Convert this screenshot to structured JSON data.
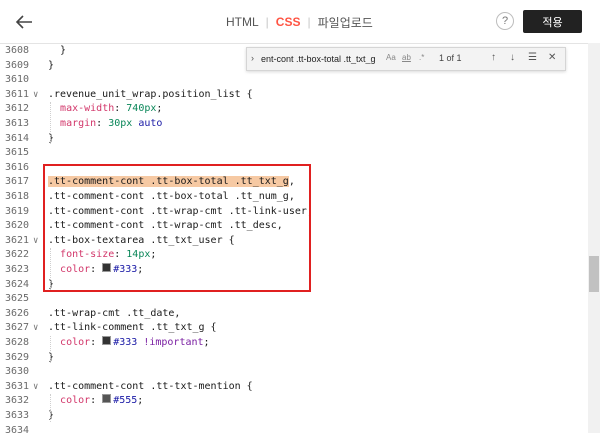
{
  "header": {
    "tabs": [
      {
        "label": "HTML",
        "active": false
      },
      {
        "label": "CSS",
        "active": true
      },
      {
        "label": "파일업로드",
        "active": false
      }
    ],
    "tab_separator": "|",
    "help_label": "?",
    "apply_label": "적용",
    "accent_color": "#ff5544"
  },
  "find": {
    "query": "ent-cont .tt-box-total .tt_txt_g",
    "opt_case": "Aa",
    "opt_word": "ab",
    "opt_regex": ".*",
    "count": "1 of 1"
  },
  "editor": {
    "lines": [
      {
        "num": "3608",
        "fold": "",
        "code": "  }"
      },
      {
        "num": "3609",
        "fold": "",
        "code": "}"
      },
      {
        "num": "3610",
        "fold": "",
        "code": ""
      },
      {
        "num": "3611",
        "fold": "∨",
        "code": ".revenue_unit_wrap.position_list {"
      },
      {
        "num": "3612",
        "fold": "",
        "code": "  max-width: 740px;"
      },
      {
        "num": "3613",
        "fold": "",
        "code": "  margin: 30px auto"
      },
      {
        "num": "3614",
        "fold": "",
        "code": "}"
      },
      {
        "num": "3615",
        "fold": "",
        "code": ""
      },
      {
        "num": "3616",
        "fold": "",
        "code": ""
      },
      {
        "num": "3617",
        "fold": "",
        "code": ".tt-comment-cont .tt-box-total .tt_txt_g,"
      },
      {
        "num": "3618",
        "fold": "",
        "code": ".tt-comment-cont .tt-box-total .tt_num_g,"
      },
      {
        "num": "3619",
        "fold": "",
        "code": ".tt-comment-cont .tt-wrap-cmt .tt-link-user,"
      },
      {
        "num": "3620",
        "fold": "",
        "code": ".tt-comment-cont .tt-wrap-cmt .tt_desc,"
      },
      {
        "num": "3621",
        "fold": "∨",
        "code": ".tt-box-textarea .tt_txt_user {"
      },
      {
        "num": "3622",
        "fold": "",
        "code": "  font-size: 14px;"
      },
      {
        "num": "3623",
        "fold": "",
        "code": "  color: #333;"
      },
      {
        "num": "3624",
        "fold": "",
        "code": "}"
      },
      {
        "num": "3625",
        "fold": "",
        "code": ""
      },
      {
        "num": "3626",
        "fold": "",
        "code": ".tt-wrap-cmt .tt_date,"
      },
      {
        "num": "3627",
        "fold": "∨",
        "code": ".tt-link-comment .tt_txt_g {"
      },
      {
        "num": "3628",
        "fold": "",
        "code": "  color: #333 !important;"
      },
      {
        "num": "3629",
        "fold": "",
        "code": "}"
      },
      {
        "num": "3630",
        "fold": "",
        "code": ""
      },
      {
        "num": "3631",
        "fold": "∨",
        "code": ".tt-comment-cont .tt-txt-mention {"
      },
      {
        "num": "3632",
        "fold": "",
        "code": "  color: #555;"
      },
      {
        "num": "3633",
        "fold": "",
        "code": "}"
      },
      {
        "num": "3634",
        "fold": "",
        "code": ""
      }
    ]
  }
}
